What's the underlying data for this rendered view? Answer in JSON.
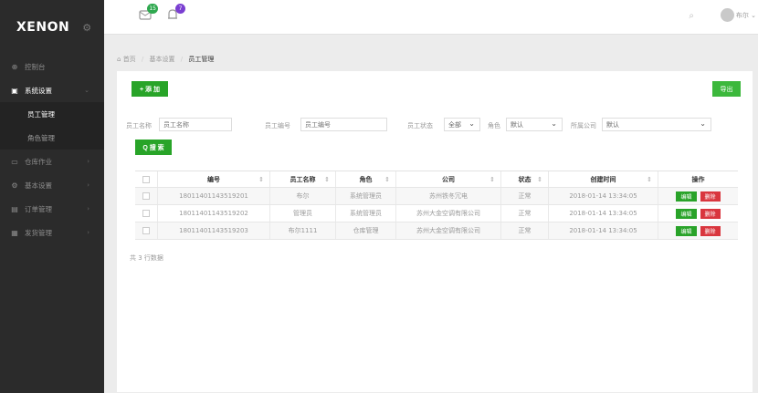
{
  "sidebar": {
    "logo": "XENON",
    "items": [
      {
        "label": "控制台",
        "icon": "globe-icon",
        "glyph": "⊕"
      },
      {
        "label": "系统设置",
        "icon": "monitor-icon",
        "glyph": "▣"
      },
      {
        "label": "仓库作业",
        "icon": "desktop-icon",
        "glyph": "▭"
      },
      {
        "label": "基本设置",
        "icon": "gear-icon",
        "glyph": "⚙"
      },
      {
        "label": "订单管理",
        "icon": "list-icon",
        "glyph": "▤"
      },
      {
        "label": "发货管理",
        "icon": "box-icon",
        "glyph": "▦"
      }
    ],
    "sub_items": [
      {
        "label": "员工管理"
      },
      {
        "label": "角色管理"
      }
    ]
  },
  "topbar": {
    "message_badge": "15",
    "notify_badge": "7",
    "user": "布尔"
  },
  "breadcrumb": {
    "home": "首页",
    "level1": "基本设置",
    "current": "员工管理"
  },
  "toolbar": {
    "add_label": "+ 添 加",
    "export_label": "导出"
  },
  "filters": {
    "name_label": "员工名称",
    "name_placeholder": "员工名称",
    "id_label": "员工编号",
    "id_placeholder": "员工编号",
    "status_label": "员工状态",
    "status_value": "全部",
    "role_label": "角色",
    "role_value": "默认",
    "company_label": "所属公司",
    "company_value": "默认",
    "search_label": "Q 搜 索"
  },
  "table": {
    "headers": [
      "编号",
      "员工名称",
      "角色",
      "公司",
      "状态",
      "创建时间",
      "操作"
    ],
    "rows": [
      {
        "id": "18011401143519201",
        "name": "布尔",
        "role": "系统管理员",
        "company": "苏州铁冬冗电",
        "status": "正常",
        "created": "2018-01-14 13:34:05"
      },
      {
        "id": "18011401143519202",
        "name": "管理员",
        "role": "系统管理员",
        "company": "苏州大金空调有限公司",
        "status": "正常",
        "created": "2018-01-14 13:34:05"
      },
      {
        "id": "18011401143519203",
        "name": "布尔1111",
        "role": "仓库管理",
        "company": "苏州大金空调有限公司",
        "status": "正常",
        "created": "2018-01-14 13:34:05"
      }
    ],
    "edit_label": "编辑",
    "delete_label": "删除"
  },
  "footer": {
    "count_text": "共 3 行数据"
  },
  "colors": {
    "sidebar_bg": "#2b2b2b",
    "primary_green": "#28a428",
    "danger_red": "#d9363e",
    "badge_green": "#2fa84f",
    "badge_purple": "#7a3fd1"
  }
}
